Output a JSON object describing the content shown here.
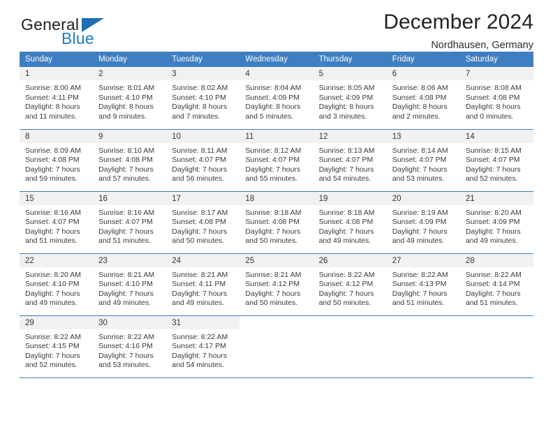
{
  "brand": {
    "name_top": "General",
    "name_bottom": "Blue",
    "triangle_color": "#1f6db5",
    "blue_color": "#1f7cc4"
  },
  "header": {
    "title": "December 2024",
    "subtitle": "Nordhausen, Germany"
  },
  "theme": {
    "header_bg": "#3f7fc1",
    "daynum_bg": "#f1f1f1",
    "text": "#3a3a3a"
  },
  "weekdays": [
    "Sunday",
    "Monday",
    "Tuesday",
    "Wednesday",
    "Thursday",
    "Friday",
    "Saturday"
  ],
  "weeks": [
    [
      {
        "day": "1",
        "sunrise": "Sunrise: 8:00 AM",
        "sunset": "Sunset: 4:11 PM",
        "daylight_1": "Daylight: 8 hours",
        "daylight_2": "and 11 minutes."
      },
      {
        "day": "2",
        "sunrise": "Sunrise: 8:01 AM",
        "sunset": "Sunset: 4:10 PM",
        "daylight_1": "Daylight: 8 hours",
        "daylight_2": "and 9 minutes."
      },
      {
        "day": "3",
        "sunrise": "Sunrise: 8:02 AM",
        "sunset": "Sunset: 4:10 PM",
        "daylight_1": "Daylight: 8 hours",
        "daylight_2": "and 7 minutes."
      },
      {
        "day": "4",
        "sunrise": "Sunrise: 8:04 AM",
        "sunset": "Sunset: 4:09 PM",
        "daylight_1": "Daylight: 8 hours",
        "daylight_2": "and 5 minutes."
      },
      {
        "day": "5",
        "sunrise": "Sunrise: 8:05 AM",
        "sunset": "Sunset: 4:09 PM",
        "daylight_1": "Daylight: 8 hours",
        "daylight_2": "and 3 minutes."
      },
      {
        "day": "6",
        "sunrise": "Sunrise: 8:06 AM",
        "sunset": "Sunset: 4:08 PM",
        "daylight_1": "Daylight: 8 hours",
        "daylight_2": "and 2 minutes."
      },
      {
        "day": "7",
        "sunrise": "Sunrise: 8:08 AM",
        "sunset": "Sunset: 4:08 PM",
        "daylight_1": "Daylight: 8 hours",
        "daylight_2": "and 0 minutes."
      }
    ],
    [
      {
        "day": "8",
        "sunrise": "Sunrise: 8:09 AM",
        "sunset": "Sunset: 4:08 PM",
        "daylight_1": "Daylight: 7 hours",
        "daylight_2": "and 59 minutes."
      },
      {
        "day": "9",
        "sunrise": "Sunrise: 8:10 AM",
        "sunset": "Sunset: 4:08 PM",
        "daylight_1": "Daylight: 7 hours",
        "daylight_2": "and 57 minutes."
      },
      {
        "day": "10",
        "sunrise": "Sunrise: 8:11 AM",
        "sunset": "Sunset: 4:07 PM",
        "daylight_1": "Daylight: 7 hours",
        "daylight_2": "and 56 minutes."
      },
      {
        "day": "11",
        "sunrise": "Sunrise: 8:12 AM",
        "sunset": "Sunset: 4:07 PM",
        "daylight_1": "Daylight: 7 hours",
        "daylight_2": "and 55 minutes."
      },
      {
        "day": "12",
        "sunrise": "Sunrise: 8:13 AM",
        "sunset": "Sunset: 4:07 PM",
        "daylight_1": "Daylight: 7 hours",
        "daylight_2": "and 54 minutes."
      },
      {
        "day": "13",
        "sunrise": "Sunrise: 8:14 AM",
        "sunset": "Sunset: 4:07 PM",
        "daylight_1": "Daylight: 7 hours",
        "daylight_2": "and 53 minutes."
      },
      {
        "day": "14",
        "sunrise": "Sunrise: 8:15 AM",
        "sunset": "Sunset: 4:07 PM",
        "daylight_1": "Daylight: 7 hours",
        "daylight_2": "and 52 minutes."
      }
    ],
    [
      {
        "day": "15",
        "sunrise": "Sunrise: 8:16 AM",
        "sunset": "Sunset: 4:07 PM",
        "daylight_1": "Daylight: 7 hours",
        "daylight_2": "and 51 minutes."
      },
      {
        "day": "16",
        "sunrise": "Sunrise: 8:16 AM",
        "sunset": "Sunset: 4:07 PM",
        "daylight_1": "Daylight: 7 hours",
        "daylight_2": "and 51 minutes."
      },
      {
        "day": "17",
        "sunrise": "Sunrise: 8:17 AM",
        "sunset": "Sunset: 4:08 PM",
        "daylight_1": "Daylight: 7 hours",
        "daylight_2": "and 50 minutes."
      },
      {
        "day": "18",
        "sunrise": "Sunrise: 8:18 AM",
        "sunset": "Sunset: 4:08 PM",
        "daylight_1": "Daylight: 7 hours",
        "daylight_2": "and 50 minutes."
      },
      {
        "day": "19",
        "sunrise": "Sunrise: 8:18 AM",
        "sunset": "Sunset: 4:08 PM",
        "daylight_1": "Daylight: 7 hours",
        "daylight_2": "and 49 minutes."
      },
      {
        "day": "20",
        "sunrise": "Sunrise: 8:19 AM",
        "sunset": "Sunset: 4:09 PM",
        "daylight_1": "Daylight: 7 hours",
        "daylight_2": "and 49 minutes."
      },
      {
        "day": "21",
        "sunrise": "Sunrise: 8:20 AM",
        "sunset": "Sunset: 4:09 PM",
        "daylight_1": "Daylight: 7 hours",
        "daylight_2": "and 49 minutes."
      }
    ],
    [
      {
        "day": "22",
        "sunrise": "Sunrise: 8:20 AM",
        "sunset": "Sunset: 4:10 PM",
        "daylight_1": "Daylight: 7 hours",
        "daylight_2": "and 49 minutes."
      },
      {
        "day": "23",
        "sunrise": "Sunrise: 8:21 AM",
        "sunset": "Sunset: 4:10 PM",
        "daylight_1": "Daylight: 7 hours",
        "daylight_2": "and 49 minutes."
      },
      {
        "day": "24",
        "sunrise": "Sunrise: 8:21 AM",
        "sunset": "Sunset: 4:11 PM",
        "daylight_1": "Daylight: 7 hours",
        "daylight_2": "and 49 minutes."
      },
      {
        "day": "25",
        "sunrise": "Sunrise: 8:21 AM",
        "sunset": "Sunset: 4:12 PM",
        "daylight_1": "Daylight: 7 hours",
        "daylight_2": "and 50 minutes."
      },
      {
        "day": "26",
        "sunrise": "Sunrise: 8:22 AM",
        "sunset": "Sunset: 4:12 PM",
        "daylight_1": "Daylight: 7 hours",
        "daylight_2": "and 50 minutes."
      },
      {
        "day": "27",
        "sunrise": "Sunrise: 8:22 AM",
        "sunset": "Sunset: 4:13 PM",
        "daylight_1": "Daylight: 7 hours",
        "daylight_2": "and 51 minutes."
      },
      {
        "day": "28",
        "sunrise": "Sunrise: 8:22 AM",
        "sunset": "Sunset: 4:14 PM",
        "daylight_1": "Daylight: 7 hours",
        "daylight_2": "and 51 minutes."
      }
    ],
    [
      {
        "day": "29",
        "sunrise": "Sunrise: 8:22 AM",
        "sunset": "Sunset: 4:15 PM",
        "daylight_1": "Daylight: 7 hours",
        "daylight_2": "and 52 minutes."
      },
      {
        "day": "30",
        "sunrise": "Sunrise: 8:22 AM",
        "sunset": "Sunset: 4:16 PM",
        "daylight_1": "Daylight: 7 hours",
        "daylight_2": "and 53 minutes."
      },
      {
        "day": "31",
        "sunrise": "Sunrise: 8:22 AM",
        "sunset": "Sunset: 4:17 PM",
        "daylight_1": "Daylight: 7 hours",
        "daylight_2": "and 54 minutes."
      },
      {
        "day": "",
        "sunrise": "",
        "sunset": "",
        "daylight_1": "",
        "daylight_2": ""
      },
      {
        "day": "",
        "sunrise": "",
        "sunset": "",
        "daylight_1": "",
        "daylight_2": ""
      },
      {
        "day": "",
        "sunrise": "",
        "sunset": "",
        "daylight_1": "",
        "daylight_2": ""
      },
      {
        "day": "",
        "sunrise": "",
        "sunset": "",
        "daylight_1": "",
        "daylight_2": ""
      }
    ]
  ]
}
